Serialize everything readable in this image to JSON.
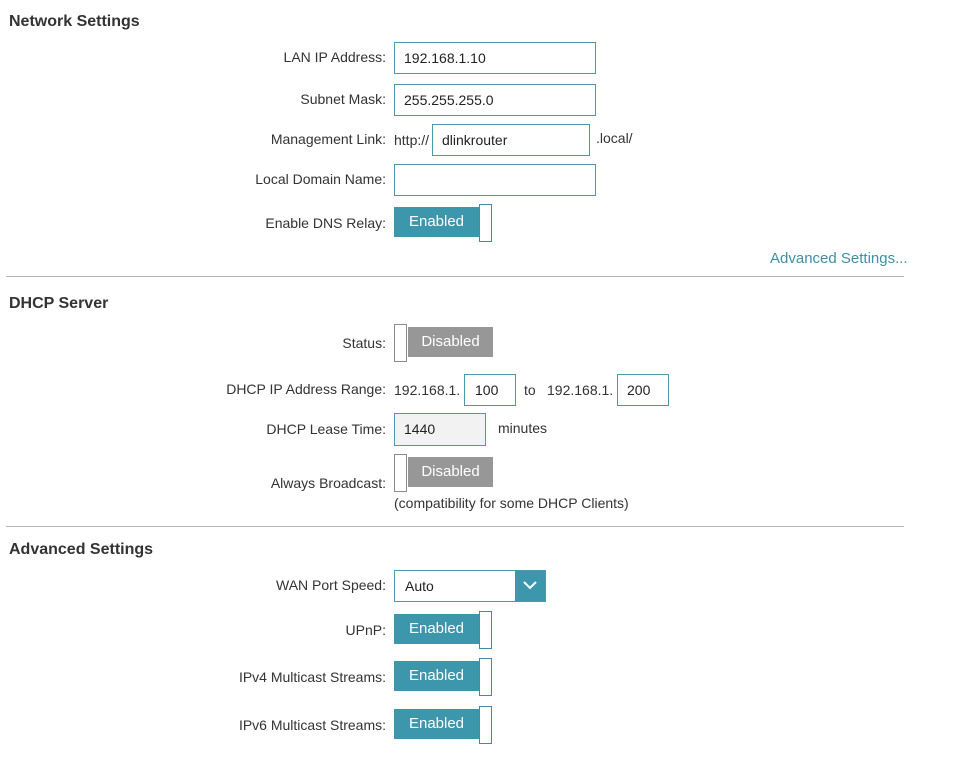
{
  "network_settings": {
    "title": "Network Settings",
    "lan_ip_label": "LAN IP Address:",
    "lan_ip_value": "192.168.1.10",
    "subnet_label": "Subnet Mask:",
    "subnet_value": "255.255.255.0",
    "mgmt_label": "Management Link:",
    "mgmt_prefix": "http://",
    "mgmt_value": "dlinkrouter",
    "mgmt_suffix": ".local/",
    "domain_label": "Local Domain Name:",
    "domain_value": "",
    "dns_relay_label": "Enable DNS Relay:",
    "dns_relay_state": "Enabled",
    "advanced_link": "Advanced Settings..."
  },
  "dhcp_server": {
    "title": "DHCP Server",
    "status_label": "Status:",
    "status_state": "Disabled",
    "range_label": "DHCP IP Address Range:",
    "range_prefix_start": "192.168.1.",
    "range_start": "100",
    "range_to": "to",
    "range_prefix_end": "192.168.1.",
    "range_end": "200",
    "lease_label": "DHCP Lease Time:",
    "lease_value": "1440",
    "lease_unit": "minutes",
    "broadcast_label": "Always Broadcast:",
    "broadcast_state": "Disabled",
    "broadcast_note": "(compatibility for some DHCP Clients)"
  },
  "advanced_settings": {
    "title": "Advanced Settings",
    "wan_speed_label": "WAN Port Speed:",
    "wan_speed_value": "Auto",
    "upnp_label": "UPnP:",
    "upnp_state": "Enabled",
    "ipv4_label": "IPv4 Multicast Streams:",
    "ipv4_state": "Enabled",
    "ipv6_label": "IPv6 Multicast Streams:",
    "ipv6_state": "Enabled"
  },
  "colors": {
    "accent": "#3c96ac",
    "toggle_off": "#979797",
    "divider": "#b5b5b5"
  }
}
